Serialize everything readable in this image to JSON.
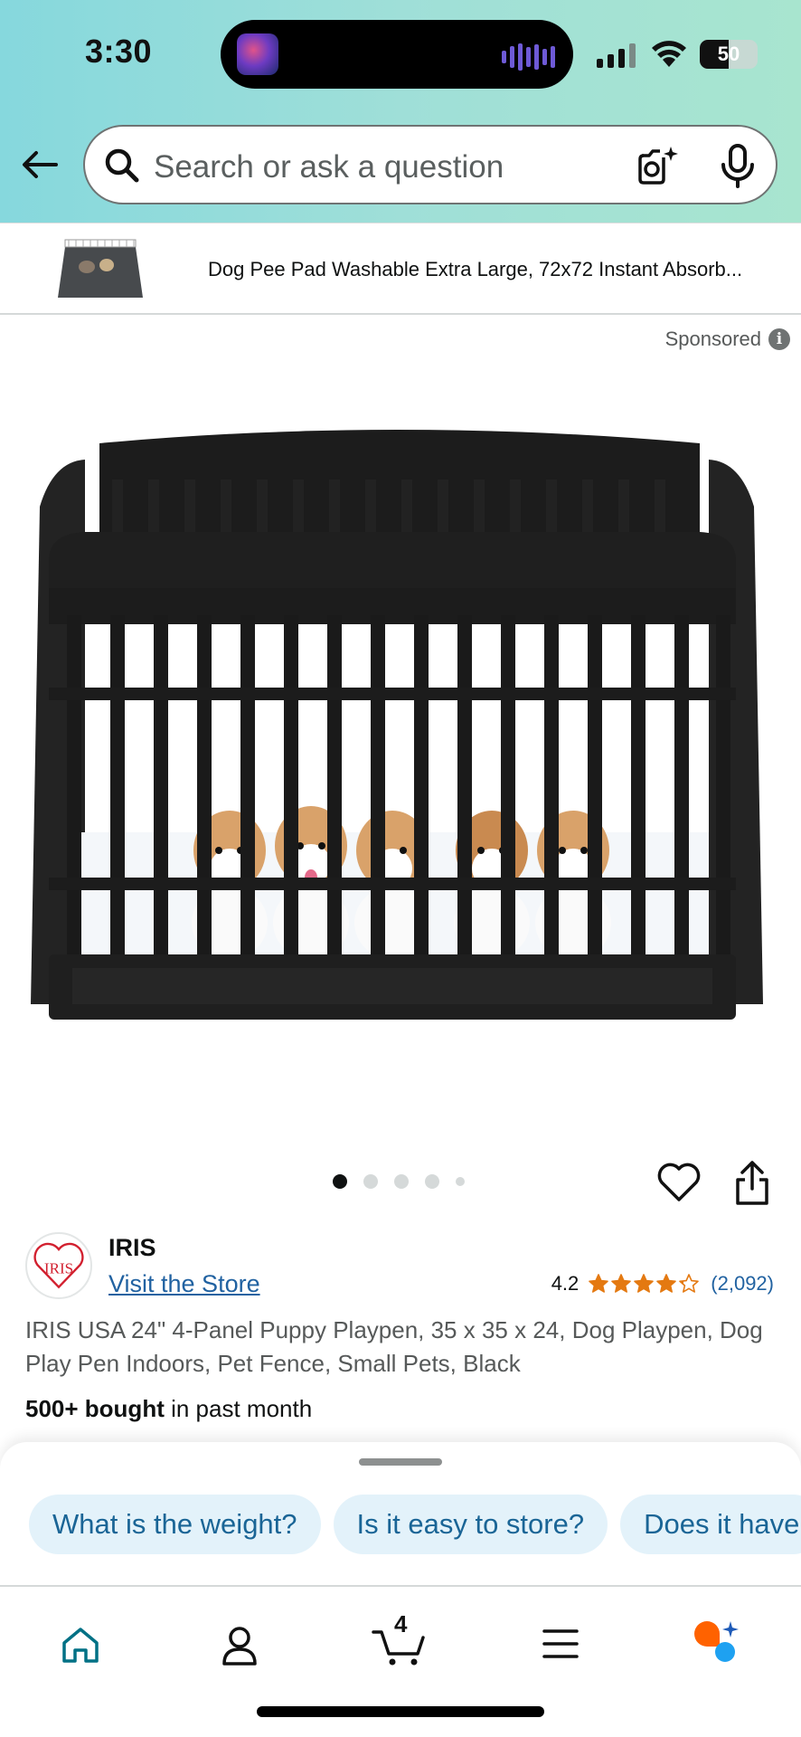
{
  "status_bar": {
    "time": "3:30",
    "battery": "50",
    "battery_level_percent": 50
  },
  "header": {
    "search_placeholder": "Search or ask a question"
  },
  "sticky_product": {
    "title": "Dog Pee Pad Washable Extra Large, 72x72 Instant Absorb..."
  },
  "sponsored_label": "Sponsored",
  "gallery": {
    "image_count": 5,
    "active_index": 0
  },
  "product": {
    "brand": "IRIS",
    "brand_logo_text": "IRIS",
    "visit_store": "Visit the Store",
    "rating": "4.2",
    "rating_value": 4.2,
    "review_count": "(2,092)",
    "title": "IRIS USA 24\" 4-Panel Puppy Playpen, 35 x 35 x 24, Dog Playpen, Dog Play Pen Indoors, Pet Fence, Small Pets, Black",
    "bought_bold": "500+ bought",
    "bought_rest": " in past month"
  },
  "questions": [
    "What is the weight?",
    "Is it easy to store?",
    "Does it have"
  ],
  "nav": {
    "cart_count": "4"
  },
  "colors": {
    "link": "#2162a1",
    "star": "#e47911",
    "chip_bg": "#e3f2fa",
    "chip_text": "#1a6596",
    "nav_active": "#007185",
    "ai_orange": "#ff6200",
    "ai_blue": "#1ea1f1"
  },
  "icons": [
    "back-arrow-icon",
    "search-icon",
    "camera-lens-icon",
    "microphone-icon",
    "info-icon",
    "heart-icon",
    "share-icon",
    "home-icon",
    "account-icon",
    "cart-icon",
    "menu-icon",
    "rufus-ai-icon"
  ]
}
